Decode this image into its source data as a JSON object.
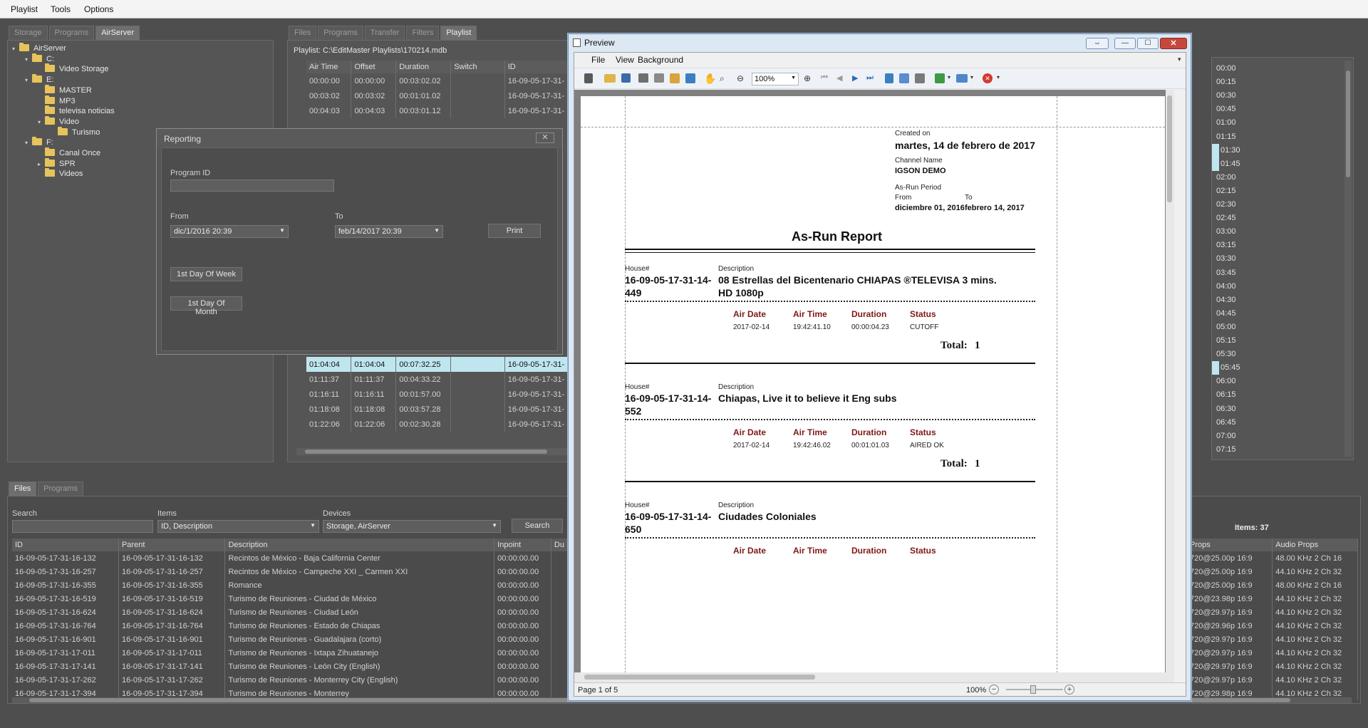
{
  "menu": [
    "Playlist",
    "Tools",
    "Options"
  ],
  "left_tabs": [
    "Storage",
    "Programs",
    "AirServer"
  ],
  "tree": [
    {
      "label": "AirServer",
      "level": 0,
      "twist": "▾"
    },
    {
      "label": "C:",
      "level": 1,
      "twist": "▾"
    },
    {
      "label": "Video Storage",
      "level": 2,
      "twist": ""
    },
    {
      "label": "E:",
      "level": 1,
      "twist": "▾"
    },
    {
      "label": "MASTER",
      "level": 2,
      "twist": ""
    },
    {
      "label": "MP3",
      "level": 2,
      "twist": ""
    },
    {
      "label": "televisa noticias",
      "level": 2,
      "twist": ""
    },
    {
      "label": "Video",
      "level": 2,
      "twist": "▾"
    },
    {
      "label": "Turismo",
      "level": 3,
      "twist": ""
    },
    {
      "label": "F:",
      "level": 1,
      "twist": "▾"
    },
    {
      "label": "Canal Once",
      "level": 2,
      "twist": ""
    },
    {
      "label": "SPR",
      "level": 2,
      "twist": "▸"
    },
    {
      "label": "Videos",
      "level": 2,
      "twist": ""
    }
  ],
  "mid_tabs": [
    "Files",
    "Programs",
    "Transfer",
    "Filters",
    "Playlist"
  ],
  "playlist_path": "Playlist: C:\\EditMaster Playlists\\170214.mdb",
  "playlist_cols": [
    "Air Time",
    "Offset",
    "Duration",
    "Switch",
    "ID"
  ],
  "playlist_top": [
    [
      "00:00:00",
      "00:00:00",
      "00:03:02.02",
      "",
      "16-09-05-17-31-"
    ],
    [
      "00:03:02",
      "00:03:02",
      "00:01:01.02",
      "",
      "16-09-05-17-31-"
    ],
    [
      "00:04:03",
      "00:04:03",
      "00:03:01.12",
      "",
      "16-09-05-17-31-"
    ]
  ],
  "playlist_bottom": [
    {
      "cells": [
        "01:04:04",
        "01:04:04",
        "00:07:32.25",
        "",
        "16-09-05-17-31-"
      ],
      "sel": true
    },
    {
      "cells": [
        "01:11:37",
        "01:11:37",
        "00:04:33.22",
        "",
        "16-09-05-17-31-"
      ],
      "sel": false
    },
    {
      "cells": [
        "01:16:11",
        "01:16:11",
        "00:01:57.00",
        "",
        "16-09-05-17-31-"
      ],
      "sel": false
    },
    {
      "cells": [
        "01:18:08",
        "01:18:08",
        "00:03:57.28",
        "",
        "16-09-05-17-31-"
      ],
      "sel": false
    },
    {
      "cells": [
        "01:22:06",
        "01:22:06",
        "00:02:30.28",
        "",
        "16-09-05-17-31-"
      ],
      "sel": false
    }
  ],
  "reporting": {
    "title": "Reporting",
    "program_id_label": "Program ID",
    "program_id_value": "",
    "from_label": "From",
    "from_value": "dic/1/2016 20:39",
    "to_label": "To",
    "to_value": "feb/14/2017 20:39",
    "print": "Print",
    "week": "1st Day Of Week",
    "month": "1st Day Of Month"
  },
  "preview": {
    "title": "Preview",
    "menu": [
      "File",
      "View",
      "Background"
    ],
    "zoom": "100%",
    "page_status": "Page 1 of 5",
    "zoom_status": "100%"
  },
  "report": {
    "created_on_label": "Created on",
    "created_on": "martes, 14 de febrero de 2017",
    "channel_label": "Channel Name",
    "channel": "IGSON DEMO",
    "period_label": "As-Run Period",
    "from_label": "From",
    "to_label": "To",
    "from": "diciembre 01, 2016",
    "to": "febrero 14, 2017",
    "title": "As-Run Report",
    "house_label": "House#",
    "desc_label": "Description",
    "col_air_date": "Air Date",
    "col_air_time": "Air Time",
    "col_duration": "Duration",
    "col_status": "Status",
    "total_label": "Total:",
    "entries": [
      {
        "house1": "16-09-05-17-31-14-",
        "house2": "449",
        "desc1": "08 Estrellas del Bicentenario CHIAPAS ®TELEVISA 3 mins.",
        "desc2": "HD 1080p",
        "date": "2017-02-14",
        "time": "19:42:41.10",
        "duration": "00:00:04.23",
        "status": "CUTOFF",
        "total": "1"
      },
      {
        "house1": "16-09-05-17-31-14-",
        "house2": "552",
        "desc1": "Chiapas, Live it to believe it Eng subs",
        "desc2": "",
        "date": "2017-02-14",
        "time": "19:42:46.02",
        "duration": "00:01:01.03",
        "status": "AIRED OK",
        "total": "1"
      },
      {
        "house1": "16-09-05-17-31-14-",
        "house2": "650",
        "desc1": "Ciudades Coloniales",
        "desc2": ""
      }
    ]
  },
  "right_times": [
    "00:00",
    "00:15",
    "00:30",
    "00:45",
    "01:00",
    "01:15",
    "01:30",
    "01:45",
    "02:00",
    "02:15",
    "02:30",
    "02:45",
    "03:00",
    "03:15",
    "03:30",
    "03:45",
    "04:00",
    "04:30",
    "04:45",
    "05:00",
    "05:15",
    "05:30",
    "05:45",
    "06:00",
    "06:15",
    "06:30",
    "06:45",
    "07:00",
    "07:15"
  ],
  "bottom_tabs": [
    "Files",
    "Programs"
  ],
  "search": {
    "search_label": "Search",
    "search_value": "",
    "items_label": "Items",
    "items_value": "ID, Description",
    "devices_label": "Devices",
    "devices_value": "Storage, AirServer",
    "button": "Search"
  },
  "items_count": "Items: 37",
  "files_cols": [
    "ID",
    "Parent",
    "Description",
    "Inpoint",
    "Du"
  ],
  "files_rows": [
    [
      "16-09-05-17-31-16-132",
      "16-09-05-17-31-16-132",
      "Recintos de México - Baja California Center",
      "00:00:00.00",
      ""
    ],
    [
      "16-09-05-17-31-16-257",
      "16-09-05-17-31-16-257",
      "Recintos de México - Campeche XXI _ Carmen XXI",
      "00:00:00.00",
      ""
    ],
    [
      "16-09-05-17-31-16-355",
      "16-09-05-17-31-16-355",
      "Romance",
      "00:00:00.00",
      ""
    ],
    [
      "16-09-05-17-31-16-519",
      "16-09-05-17-31-16-519",
      "Turismo de Reuniones - Ciudad de México",
      "00:00:00.00",
      ""
    ],
    [
      "16-09-05-17-31-16-624",
      "16-09-05-17-31-16-624",
      "Turismo de Reuniones - Ciudad León",
      "00:00:00.00",
      ""
    ],
    [
      "16-09-05-17-31-16-764",
      "16-09-05-17-31-16-764",
      "Turismo de Reuniones - Estado de Chiapas",
      "00:00:00.00",
      ""
    ],
    [
      "16-09-05-17-31-16-901",
      "16-09-05-17-31-16-901",
      "Turismo de Reuniones - Guadalajara (corto)",
      "00:00:00.00",
      ""
    ],
    [
      "16-09-05-17-31-17-011",
      "16-09-05-17-31-17-011",
      "Turismo de Reuniones - Ixtapa Zihuatanejo",
      "00:00:00.00",
      ""
    ],
    [
      "16-09-05-17-31-17-141",
      "16-09-05-17-31-17-141",
      "Turismo de Reuniones - León City (English)",
      "00:00:00.00",
      ""
    ],
    [
      "16-09-05-17-31-17-262",
      "16-09-05-17-31-17-262",
      "Turismo de Reuniones - Monterrey City (English)",
      "00:00:00.00",
      ""
    ],
    [
      "16-09-05-17-31-17-394",
      "16-09-05-17-31-17-394",
      "Turismo de Reuniones - Monterrey",
      "00:00:00.00",
      ""
    ]
  ],
  "right_cols": [
    "Props",
    "Audio Props"
  ],
  "right_rows": [
    [
      "720@25.00p 16:9",
      "48.00 KHz 2 Ch 16"
    ],
    [
      "720@25.00p 16:9",
      "44.10 KHz 2 Ch 32"
    ],
    [
      "720@25.00p 16:9",
      "48.00 KHz 2 Ch 16"
    ],
    [
      "720@23.98p 16:9",
      "44.10 KHz 2 Ch 32"
    ],
    [
      "720@29.97p 16:9",
      "44.10 KHz 2 Ch 32"
    ],
    [
      "720@29.96p 16:9",
      "44.10 KHz 2 Ch 32"
    ],
    [
      "720@29.97p 16:9",
      "44.10 KHz 2 Ch 32"
    ],
    [
      "720@29.97p 16:9",
      "44.10 KHz 2 Ch 32"
    ],
    [
      "720@29.97p 16:9",
      "44.10 KHz 2 Ch 32"
    ],
    [
      "720@29.97p 16:9",
      "44.10 KHz 2 Ch 32"
    ],
    [
      "720@29.98p 16:9",
      "44.10 KHz 2 Ch 32"
    ]
  ]
}
